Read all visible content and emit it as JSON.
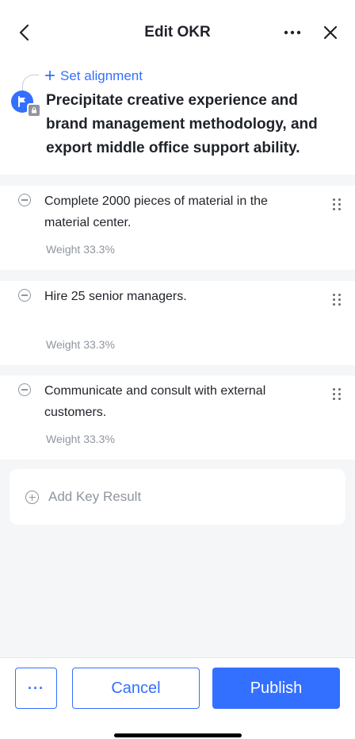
{
  "header": {
    "title": "Edit OKR"
  },
  "objective": {
    "set_alignment_label": "Set alignment",
    "text": "Precipitate creative experience and brand management methodology, and export middle office support ability."
  },
  "key_results": [
    {
      "text": "Complete 2000 pieces of material in the material center.",
      "weight": "Weight 33.3%"
    },
    {
      "text": "Hire 25 senior managers.",
      "weight": "Weight 33.3%"
    },
    {
      "text": "Communicate and consult with external customers.",
      "weight": "Weight 33.3%"
    }
  ],
  "add_key_result_label": "Add Key Result",
  "footer": {
    "more_label": "···",
    "cancel_label": "Cancel",
    "publish_label": "Publish"
  },
  "colors": {
    "accent": "#3370ff",
    "muted": "#8f959e",
    "background": "#f5f6f7"
  }
}
